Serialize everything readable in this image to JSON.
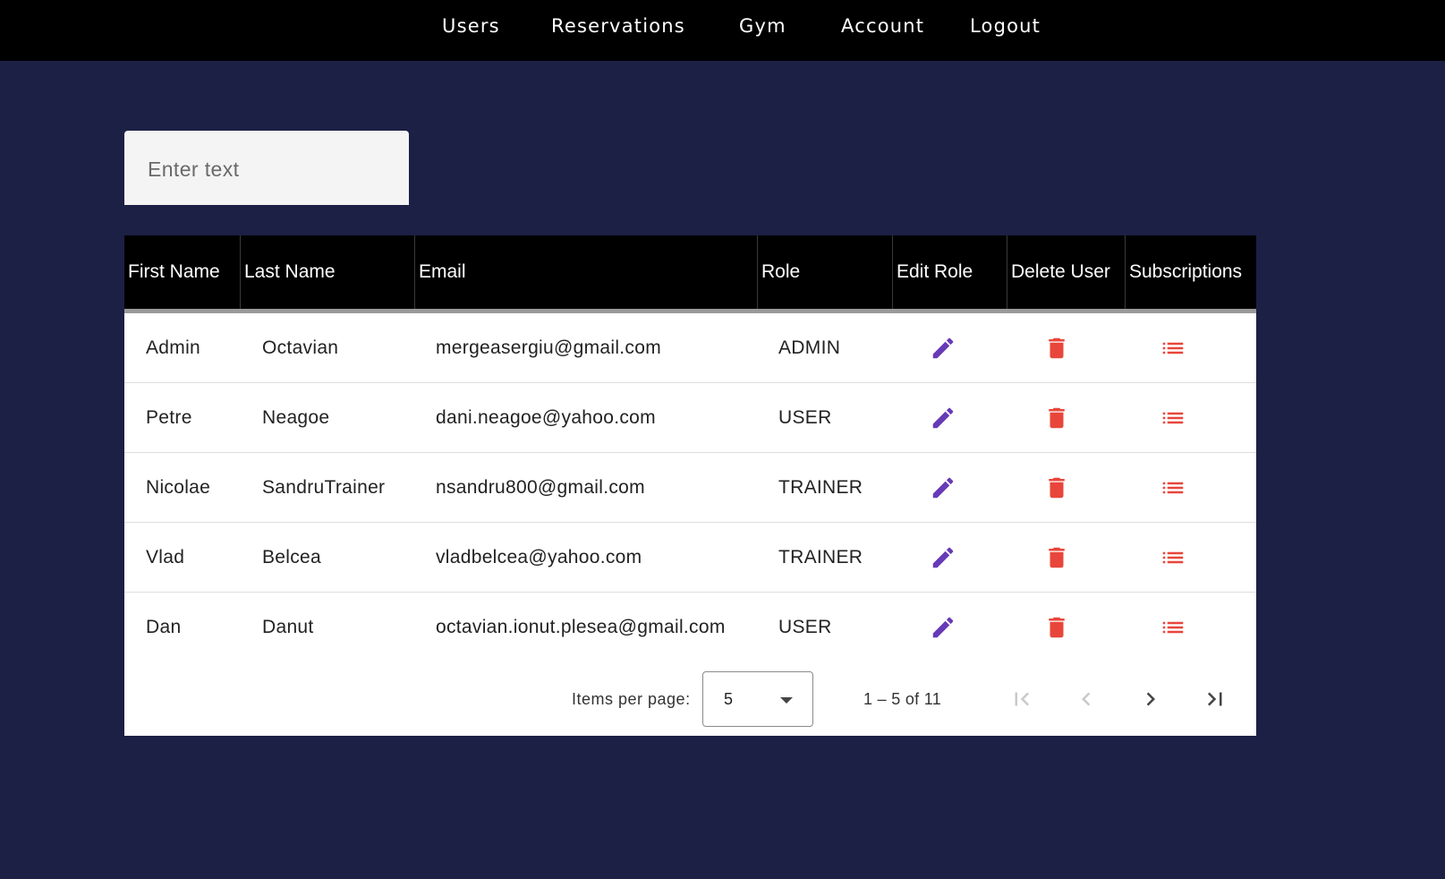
{
  "nav": {
    "users": "Users",
    "reservations": "Reservations",
    "gym": "Gym",
    "account": "Account",
    "logout": "Logout"
  },
  "search": {
    "placeholder": "Enter text",
    "value": ""
  },
  "table": {
    "headers": {
      "first_name": "First Name",
      "last_name": "Last Name",
      "email": "Email",
      "role": "Role",
      "edit_role": "Edit Role",
      "delete_user": "Delete User",
      "subscriptions": "Subscriptions"
    },
    "rows": [
      {
        "first": "Admin",
        "last": "Octavian",
        "email": "mergeasergiu@gmail.com",
        "role": "ADMIN"
      },
      {
        "first": "Petre",
        "last": "Neagoe",
        "email": "dani.neagoe@yahoo.com",
        "role": "USER"
      },
      {
        "first": "Nicolae",
        "last": "SandruTrainer",
        "email": "nsandru800@gmail.com",
        "role": "TRAINER"
      },
      {
        "first": "Vlad",
        "last": "Belcea",
        "email": "vladbelcea@yahoo.com",
        "role": "TRAINER"
      },
      {
        "first": "Dan",
        "last": "Danut",
        "email": "octavian.ionut.plesea@gmail.com",
        "role": "USER"
      }
    ],
    "icons": {
      "edit": "pencil-icon",
      "delete": "trash-icon",
      "subscriptions": "list-icon"
    },
    "colors": {
      "edit": "#673ab7",
      "delete": "#e8463b",
      "subscriptions": "#e8463b"
    }
  },
  "paginator": {
    "items_per_page_label": "Items per page:",
    "page_size": "5",
    "range_label": "1 – 5 of 11",
    "icons": {
      "first": "first-page-icon",
      "prev": "chevron-left-icon",
      "next": "chevron-right-icon",
      "last": "last-page-icon"
    }
  }
}
